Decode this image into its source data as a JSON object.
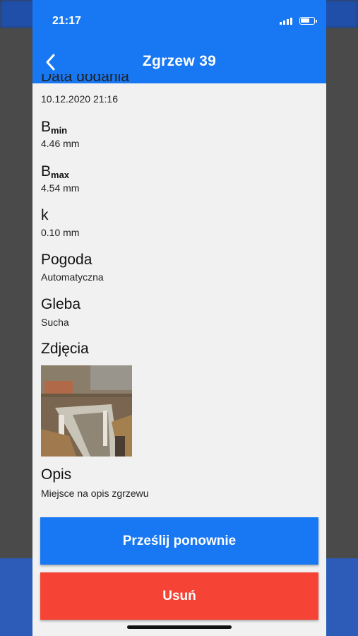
{
  "status": {
    "time": "21:17"
  },
  "header": {
    "title": "Zgrzew 39"
  },
  "fields": {
    "date_label": "Data dodania",
    "date_value": "10.12.2020 21:16",
    "bmin_main": "B",
    "bmin_sub": "min",
    "bmin_value": "4.46 mm",
    "bmax_main": "B",
    "bmax_sub": "max",
    "bmax_value": "4.54 mm",
    "k_label": "k",
    "k_value": "0.10 mm",
    "weather_label": "Pogoda",
    "weather_value": "Automatyczna",
    "soil_label": "Gleba",
    "soil_value": "Sucha",
    "photos_label": "Zdjęcia",
    "desc_label": "Opis",
    "desc_value": "Miejsce na opis zgrzewu"
  },
  "buttons": {
    "resend": "Prześlij ponownie",
    "delete": "Usuń"
  },
  "colors": {
    "primary": "#1877f2",
    "danger": "#f54335"
  }
}
